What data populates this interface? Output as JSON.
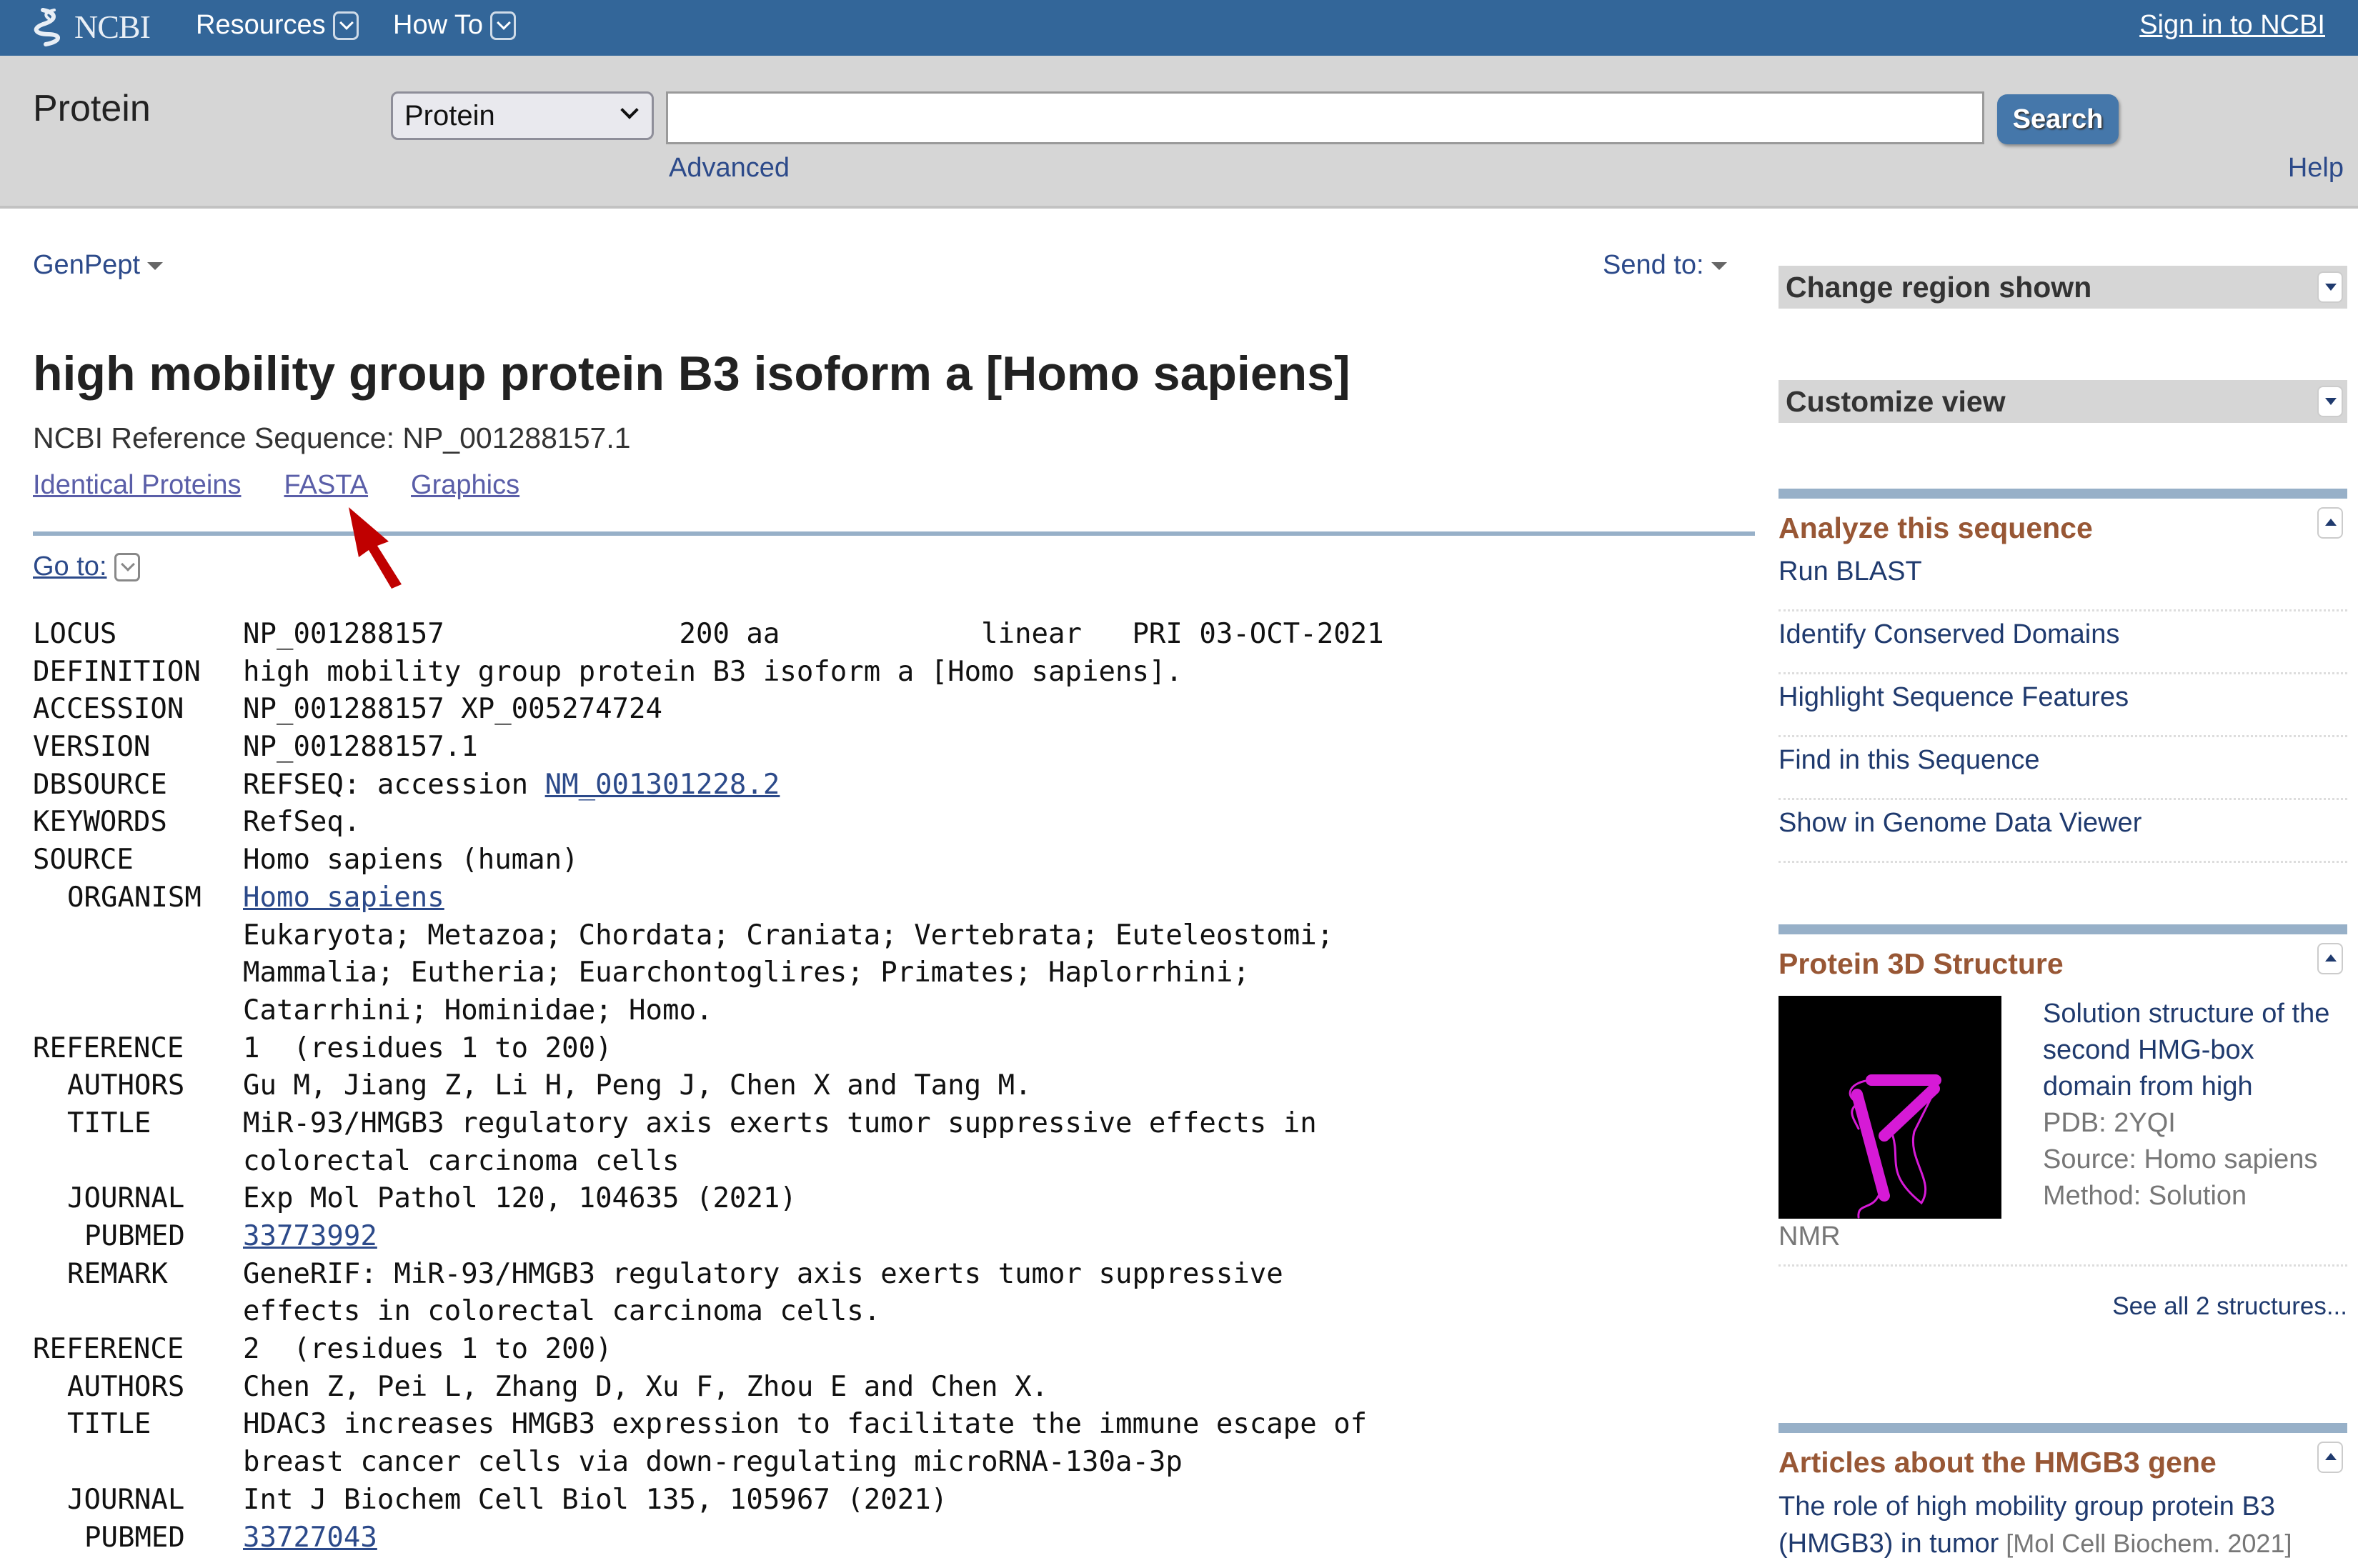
{
  "header": {
    "logo_text": "NCBI",
    "nav": [
      {
        "label": "Resources"
      },
      {
        "label": "How To"
      }
    ],
    "signin_label": "Sign in to NCBI"
  },
  "search": {
    "database_title": "Protein",
    "db_select_value": "Protein",
    "query_value": "",
    "query_placeholder": "",
    "search_button": "Search",
    "advanced_link": "Advanced",
    "help_link": "Help"
  },
  "toolbar": {
    "format_label": "GenPept",
    "send_to_label": "Send to:"
  },
  "record_header": {
    "title": "high mobility group protein B3 isoform a [Homo sapiens]",
    "refseq_line": "NCBI Reference Sequence: NP_001288157.1",
    "links": [
      "Identical Proteins",
      "FASTA",
      "Graphics"
    ],
    "goto_label": "Go to:"
  },
  "record": {
    "rows": [
      {
        "key": "LOCUS",
        "indent": 0,
        "value": "NP_001288157              200 aa            linear   PRI 03-OCT-2021"
      },
      {
        "key": "DEFINITION",
        "indent": 0,
        "value": "high mobility group protein B3 isoform a [Homo sapiens]."
      },
      {
        "key": "ACCESSION",
        "indent": 0,
        "value": "NP_001288157 XP_005274724"
      },
      {
        "key": "VERSION",
        "indent": 0,
        "value": "NP_001288157.1"
      },
      {
        "key": "DBSOURCE",
        "indent": 0,
        "value": "REFSEQ: accession ",
        "link": "NM_001301228.2"
      },
      {
        "key": "KEYWORDS",
        "indent": 0,
        "value": "RefSeq."
      },
      {
        "key": "SOURCE",
        "indent": 0,
        "value": "Homo sapiens (human)"
      },
      {
        "key": "ORGANISM",
        "indent": 1,
        "value": "",
        "link": "Homo sapiens"
      },
      {
        "key": "",
        "indent": 0,
        "value": "Eukaryota; Metazoa; Chordata; Craniata; Vertebrata; Euteleostomi;"
      },
      {
        "key": "",
        "indent": 0,
        "value": "Mammalia; Eutheria; Euarchontoglires; Primates; Haplorrhini;"
      },
      {
        "key": "",
        "indent": 0,
        "value": "Catarrhini; Hominidae; Homo."
      },
      {
        "key": "REFERENCE",
        "indent": 0,
        "value": "1  (residues 1 to 200)"
      },
      {
        "key": "AUTHORS",
        "indent": 1,
        "value": "Gu M, Jiang Z, Li H, Peng J, Chen X and Tang M."
      },
      {
        "key": "TITLE",
        "indent": 1,
        "value": "MiR-93/HMGB3 regulatory axis exerts tumor suppressive effects in"
      },
      {
        "key": "",
        "indent": 0,
        "value": "colorectal carcinoma cells"
      },
      {
        "key": "JOURNAL",
        "indent": 1,
        "value": "Exp Mol Pathol 120, 104635 (2021)"
      },
      {
        "key": "PUBMED",
        "indent": 2,
        "value": "",
        "link": "33773992"
      },
      {
        "key": "REMARK",
        "indent": 1,
        "value": "GeneRIF: MiR-93/HMGB3 regulatory axis exerts tumor suppressive"
      },
      {
        "key": "",
        "indent": 0,
        "value": "effects in colorectal carcinoma cells."
      },
      {
        "key": "REFERENCE",
        "indent": 0,
        "value": "2  (residues 1 to 200)"
      },
      {
        "key": "AUTHORS",
        "indent": 1,
        "value": "Chen Z, Pei L, Zhang D, Xu F, Zhou E and Chen X."
      },
      {
        "key": "TITLE",
        "indent": 1,
        "value": "HDAC3 increases HMGB3 expression to facilitate the immune escape of"
      },
      {
        "key": "",
        "indent": 0,
        "value": "breast cancer cells via down-regulating microRNA-130a-3p"
      },
      {
        "key": "JOURNAL",
        "indent": 1,
        "value": "Int J Biochem Cell Biol 135, 105967 (2021)"
      },
      {
        "key": "PUBMED",
        "indent": 2,
        "value": "",
        "link": "33727043"
      }
    ]
  },
  "sidebar": {
    "change_region": "Change region shown",
    "customize_view": "Customize view",
    "analyze": {
      "title": "Analyze this sequence",
      "links": [
        "Run BLAST",
        "Identify Conserved Domains",
        "Highlight Sequence Features",
        "Find in this Sequence",
        "Show in Genome Data Viewer"
      ]
    },
    "structure": {
      "title": "Protein 3D Structure",
      "name": "Solution structure of the second HMG-box domain from high",
      "pdb": "PDB: 2YQI",
      "source": "Source: Homo sapiens",
      "method": "Method: Solution",
      "method_cont": "NMR",
      "see_all": "See all 2 structures..."
    },
    "articles": {
      "title": "Articles about the HMGB3 gene",
      "items": [
        {
          "title": "The role of high mobility group protein B3 (HMGB3) in tumor",
          "journal": "[Mol Cell Biochem. 2021]"
        }
      ]
    }
  },
  "colors": {
    "topbar": "#336699",
    "link": "#2c4a8a",
    "visited_link": "#5a5ea8",
    "portlet_title": "#985735",
    "annotation_arrow": "#c00000"
  }
}
